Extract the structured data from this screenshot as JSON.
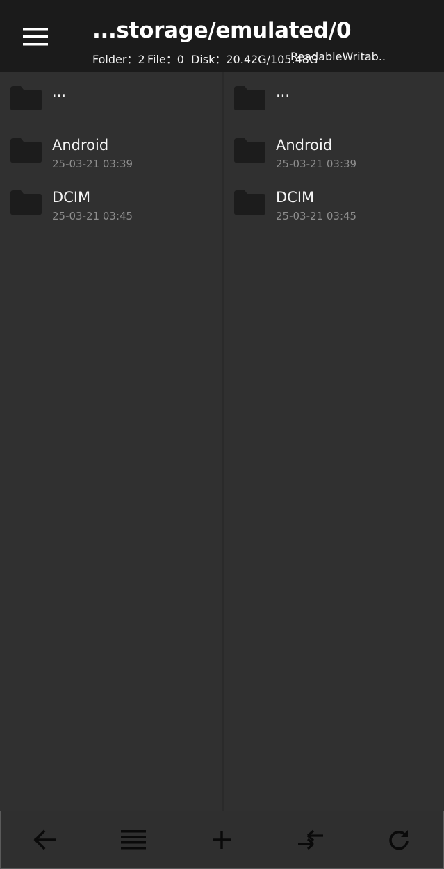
{
  "header": {
    "menu_icon": "hamburger-menu-icon",
    "path": "...storage/emulated/0",
    "stats": {
      "folder": "Folder：2",
      "file": "File：0",
      "disk": "Disk：20.42G/105.48G",
      "permissions": "ReadableWritab.."
    }
  },
  "left_pane": {
    "items": [
      {
        "name": "...",
        "date": "",
        "icon": "folder-icon"
      },
      {
        "name": "Android",
        "date": "25-03-21 03:39",
        "icon": "folder-icon"
      },
      {
        "name": "DCIM",
        "date": "25-03-21 03:45",
        "icon": "folder-icon"
      }
    ]
  },
  "right_pane": {
    "items": [
      {
        "name": "...",
        "date": "",
        "icon": "folder-icon"
      },
      {
        "name": "Android",
        "date": "25-03-21 03:39",
        "icon": "folder-icon"
      },
      {
        "name": "DCIM",
        "date": "25-03-21 03:45",
        "icon": "folder-icon"
      }
    ]
  },
  "toolbar": {
    "buttons": [
      {
        "icon": "back-arrow-icon"
      },
      {
        "icon": "list-icon"
      },
      {
        "icon": "plus-icon"
      },
      {
        "icon": "swap-arrows-icon"
      },
      {
        "icon": "refresh-icon"
      }
    ]
  },
  "colors": {
    "header_bg": "#1b1b1b",
    "pane_bg": "#303030",
    "folder_icon": "#1c1c1c",
    "text_primary": "#f5f5f5",
    "text_secondary": "#8e8e8e",
    "toolbar_icon": "#0a0a0a"
  }
}
